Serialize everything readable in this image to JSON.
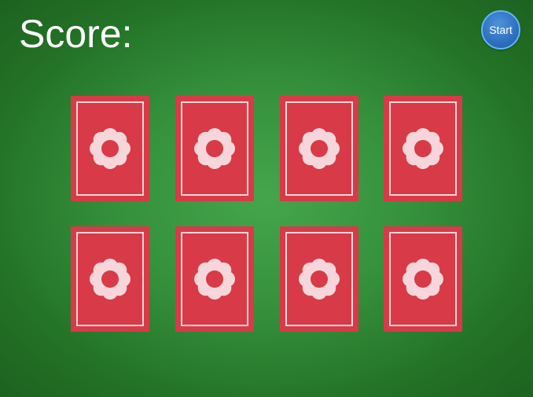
{
  "header": {
    "score_label": "Score:",
    "start_label": "Start"
  },
  "colors": {
    "felt": "#3a9a42",
    "card_back": "#d83a47",
    "card_pattern": "#f6d6da",
    "start_button": "#2f6fc0"
  },
  "cards": [
    {
      "state": "face-down",
      "back_icon": "flower-icon"
    },
    {
      "state": "face-down",
      "back_icon": "flower-icon"
    },
    {
      "state": "face-down",
      "back_icon": "flower-icon"
    },
    {
      "state": "face-down",
      "back_icon": "flower-icon"
    },
    {
      "state": "face-down",
      "back_icon": "flower-icon"
    },
    {
      "state": "face-down",
      "back_icon": "flower-icon"
    },
    {
      "state": "face-down",
      "back_icon": "flower-icon"
    },
    {
      "state": "face-down",
      "back_icon": "flower-icon"
    }
  ]
}
